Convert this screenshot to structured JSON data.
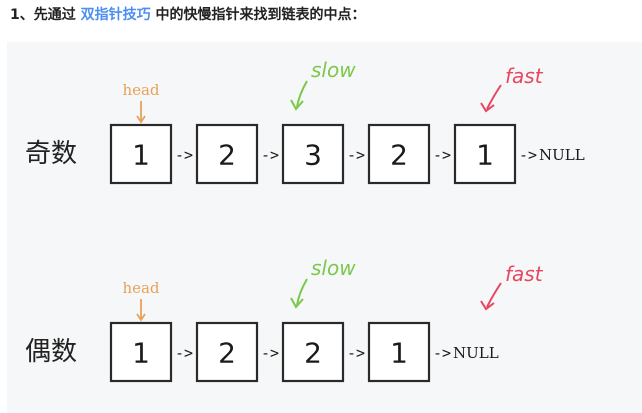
{
  "heading": {
    "prefix": "1、先通过 ",
    "link": "双指针技巧",
    "suffix": " 中的快慢指针来找到链表的中点："
  },
  "rows": [
    {
      "label": "奇数",
      "nodes": [
        "1",
        "2",
        "3",
        "2",
        "1"
      ],
      "terminal": "NULL"
    },
    {
      "label": "偶数",
      "nodes": [
        "1",
        "2",
        "2",
        "1"
      ],
      "terminal": "NULL"
    }
  ],
  "arrow_text": "->",
  "pointers": {
    "head": "head",
    "slow": "slow",
    "fast": "fast"
  },
  "colors": {
    "link": "#4d8ff0",
    "head": "#e8a25a",
    "slow": "#7cc84a",
    "fast": "#e8465f",
    "panel": "#f6f7f8"
  }
}
